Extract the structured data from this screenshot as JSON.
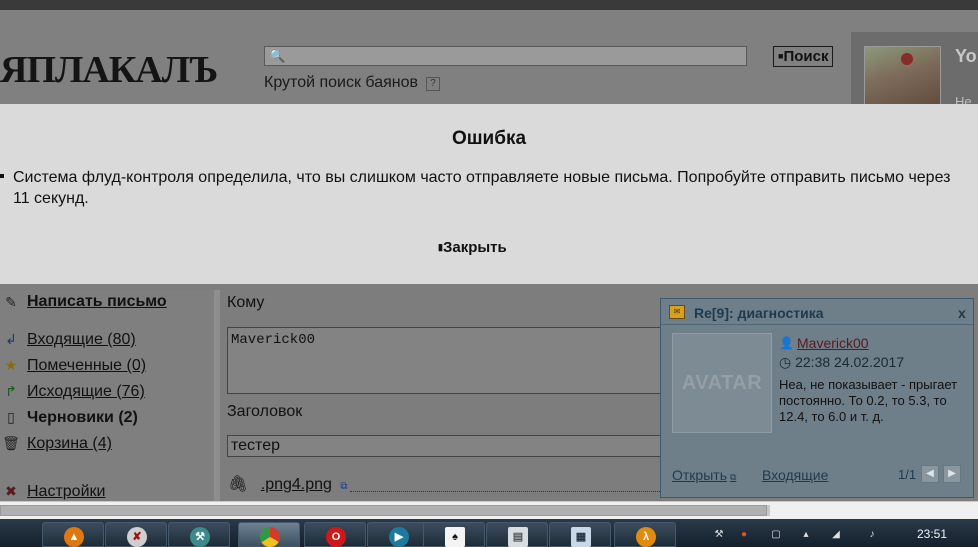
{
  "header": {
    "logo": "ЯПЛАКАЛЪ",
    "search_placeholder": "",
    "search_button": "Поиск",
    "search_subtitle": "Крутой поиск баянов",
    "help_mark": "?",
    "user_name": "Yo",
    "user_sub": "Не"
  },
  "modal": {
    "title": "Ошибка",
    "message": "Система флуд-контроля определила, что вы слишком часто отправляете новые письма. Попробуйте отправить письмо через 11 секунд.",
    "close_label": "Закрыть"
  },
  "sidebar": {
    "items": [
      {
        "label": "Написать письмо",
        "icon": "pencil-icon"
      },
      {
        "label": "Входящие (80)",
        "icon": "inbox-icon"
      },
      {
        "label": "Помеченные (0)",
        "icon": "star-icon"
      },
      {
        "label": "Исходящие (76)",
        "icon": "outbox-icon"
      },
      {
        "label": "Черновики (2)",
        "icon": "draft-icon"
      },
      {
        "label": "Корзина (4)",
        "icon": "trash-icon"
      },
      {
        "label": "Настройки",
        "icon": "settings-icon"
      }
    ]
  },
  "compose": {
    "to_label": "Кому",
    "to_value": "Maverick00",
    "subject_label": "Заголовок",
    "subject_value": "тестер",
    "attachment": ".png4.png"
  },
  "notification": {
    "title": "Re[9]: диагностика",
    "close": "x",
    "avatar_placeholder": "AVATAR",
    "author": "Maverick00",
    "time": "22:38 24.02.2017",
    "text": "Неа, не показывает - прыгает постоянно. То 0.2, то 5.3, то 12.4, то 6.0 и т. д.",
    "open_link": "Открыть",
    "inbox_link": "Входящие",
    "page": "1/1"
  },
  "taskbar": {
    "apps": [
      "vlc-icon",
      "paint-icon",
      "tool-icon",
      "chrome-icon",
      "opera-icon",
      "media-player-icon",
      "solitaire-icon",
      "document-icon",
      "calculator-icon",
      "half-life-icon"
    ],
    "active_index": 3,
    "clock": "23:51"
  }
}
